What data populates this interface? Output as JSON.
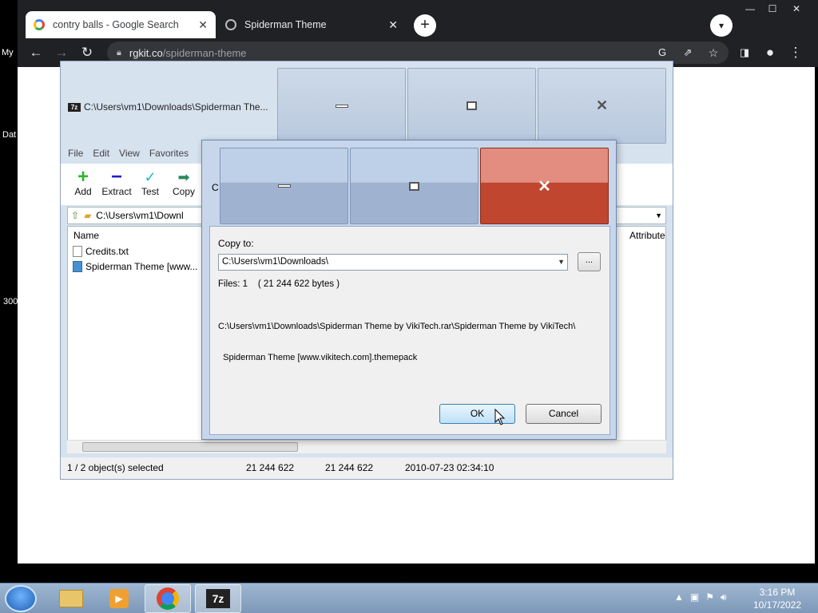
{
  "browser": {
    "tabs": [
      {
        "title": "contry balls - Google Search",
        "close": "✕"
      },
      {
        "title": "Spiderman Theme",
        "close": "✕"
      }
    ],
    "new_tab": "+",
    "url_host": "rgkit.co",
    "url_path": "/spiderman-theme",
    "window_controls": [
      "—",
      "☐",
      "✕"
    ]
  },
  "desktop_fragments": {
    "top": "My",
    "mid": "Dat",
    "bottom": "300"
  },
  "sevenzip": {
    "title": "C:\\Users\\vm1\\Downloads\\Spiderman The...",
    "menu": [
      "File",
      "Edit",
      "View",
      "Favorites"
    ],
    "toolbar": [
      "Add",
      "Extract",
      "Test",
      "Copy"
    ],
    "address": "C:\\Users\\vm1\\Downl",
    "columns": {
      "name": "Name",
      "attributes": "Attribute"
    },
    "files": [
      "Credits.txt",
      "Spiderman Theme [www..."
    ],
    "status": {
      "selected": "1 / 2 object(s) selected",
      "size": "21 244 622",
      "packed": "21 244 622",
      "modified": "2010-07-23 02:34:10"
    }
  },
  "dialog": {
    "stray_letter": "C",
    "copy_to_label": "Copy to:",
    "copy_to_value": "C:\\Users\\vm1\\Downloads\\",
    "browse_label": "...",
    "files_line": "Files: 1    ( 21 244 622 bytes )",
    "path_line1": "C:\\Users\\vm1\\Downloads\\Spiderman Theme by VikiTech.rar\\Spiderman Theme by VikiTech\\",
    "path_line2": "  Spiderman Theme [www.vikitech.com].themepack",
    "ok_label": "OK",
    "cancel_label": "Cancel"
  },
  "taskbar": {
    "time": "3:16 PM",
    "date": "10/17/2022",
    "active_app_label": "7z"
  },
  "colors": {
    "close_red": "#c04630",
    "chrome_dark": "#202124",
    "dialog_frame": "#c7d6ea"
  }
}
